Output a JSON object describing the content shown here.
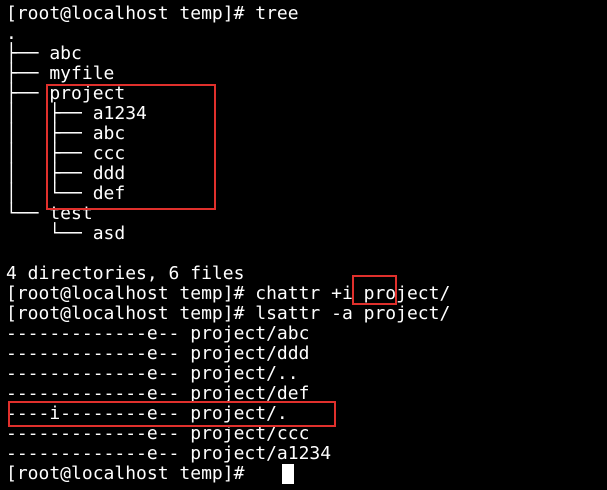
{
  "terminal": {
    "lines": [
      "[root@localhost temp]# tree",
      ".",
      "├── abc",
      "├── myfile",
      "├── project",
      "│   ├── a1234",
      "│   ├── abc",
      "│   ├── ccc",
      "│   ├── ddd",
      "│   └── def",
      "└── test",
      "    └── asd",
      "",
      "4 directories, 6 files",
      "[root@localhost temp]# chattr +i project/",
      "[root@localhost temp]# lsattr -a project/",
      "-------------e-- project/abc",
      "-------------e-- project/ddd",
      "-------------e-- project/..",
      "-------------e-- project/def",
      "----i--------e-- project/.",
      "-------------e-- project/ccc",
      "-------------e-- project/a1234",
      "[root@localhost temp]# "
    ]
  },
  "colors": {
    "background": "#000000",
    "text": "#ffffff",
    "highlight": "#e0302c"
  }
}
